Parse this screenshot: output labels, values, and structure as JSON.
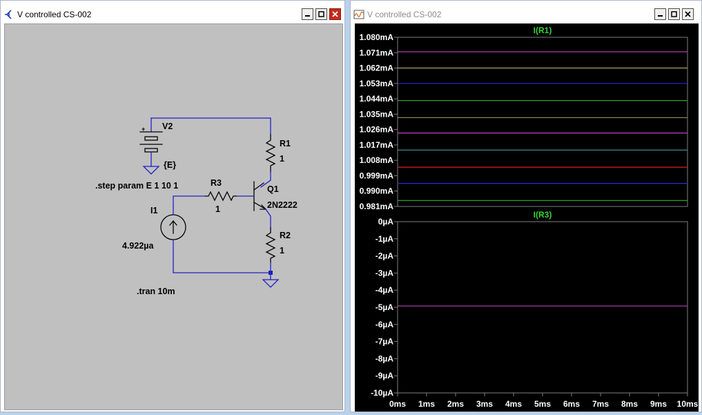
{
  "schematic_window": {
    "title": "V controlled CS-002",
    "icon": "schematic-icon"
  },
  "waveform_window": {
    "title": "V controlled CS-002",
    "icon": "waveform-icon"
  },
  "window_buttons": [
    "minimize-icon",
    "restore-icon",
    "close-icon"
  ],
  "schematic": {
    "v2": {
      "name": "V2",
      "value": "{E}",
      "polarity": "+"
    },
    "r1": {
      "name": "R1",
      "value": "1"
    },
    "r2": {
      "name": "R2",
      "value": "1"
    },
    "r3": {
      "name": "R3",
      "value": "1"
    },
    "q1": {
      "name": "Q1",
      "model": "2N2222"
    },
    "i1": {
      "name": "I1",
      "value": "4.922µa"
    },
    "directives": {
      "step": ".step param E 1 10 1",
      "tran": ".tran 10m"
    }
  },
  "colors": {
    "wire": "#1f1fc8",
    "component": "#000000",
    "plot_bg": "#000000",
    "grid": "#7f7f7f",
    "label": "#39d339",
    "tick_text": "#ffffff"
  },
  "chart_data": [
    {
      "type": "line",
      "title": "I(R1)",
      "xlabel": "",
      "ylabel": "",
      "x": [
        0,
        10
      ],
      "xunit": "ms",
      "xlim": [
        0,
        10
      ],
      "ylim": [
        0.981,
        1.08
      ],
      "yticks": [
        "1.080mA",
        "1.071mA",
        "1.062mA",
        "1.053mA",
        "1.044mA",
        "1.035mA",
        "1.026mA",
        "1.017mA",
        "1.008mA",
        "0.999mA",
        "0.990mA",
        "0.981mA"
      ],
      "series": [
        {
          "color": "#b040b0",
          "values": [
            1.0715,
            1.0715
          ]
        },
        {
          "color": "#b0a060",
          "values": [
            1.062,
            1.062
          ]
        },
        {
          "color": "#2030d8",
          "values": [
            1.053,
            1.053
          ]
        },
        {
          "color": "#30a030",
          "values": [
            1.043,
            1.043
          ]
        },
        {
          "color": "#a09060",
          "values": [
            1.033,
            1.033
          ]
        },
        {
          "color": "#c040c0",
          "values": [
            1.024,
            1.024
          ]
        },
        {
          "color": "#40a0a0",
          "values": [
            1.014,
            1.014
          ]
        },
        {
          "color": "#e02020",
          "values": [
            1.004,
            1.004
          ]
        },
        {
          "color": "#2030d8",
          "values": [
            0.9945,
            0.9945
          ]
        },
        {
          "color": "#30b030",
          "values": [
            0.9845,
            0.9845
          ]
        }
      ]
    },
    {
      "type": "line",
      "title": "I(R3)",
      "xlabel": "",
      "ylabel": "",
      "x": [
        0,
        10
      ],
      "xunit": "ms",
      "xlim": [
        0,
        10
      ],
      "ylim": [
        -10,
        0
      ],
      "yunit": "µA",
      "yticks": [
        "0µA",
        "-1µA",
        "-2µA",
        "-3µA",
        "-4µA",
        "-5µA",
        "-6µA",
        "-7µA",
        "-8µA",
        "-9µA",
        "-10µA"
      ],
      "xticks": [
        "0ms",
        "1ms",
        "2ms",
        "3ms",
        "4ms",
        "5ms",
        "6ms",
        "7ms",
        "8ms",
        "9ms",
        "10ms"
      ],
      "series": [
        {
          "color": "#a040a0",
          "values": [
            -4.922,
            -4.922
          ]
        }
      ]
    }
  ]
}
